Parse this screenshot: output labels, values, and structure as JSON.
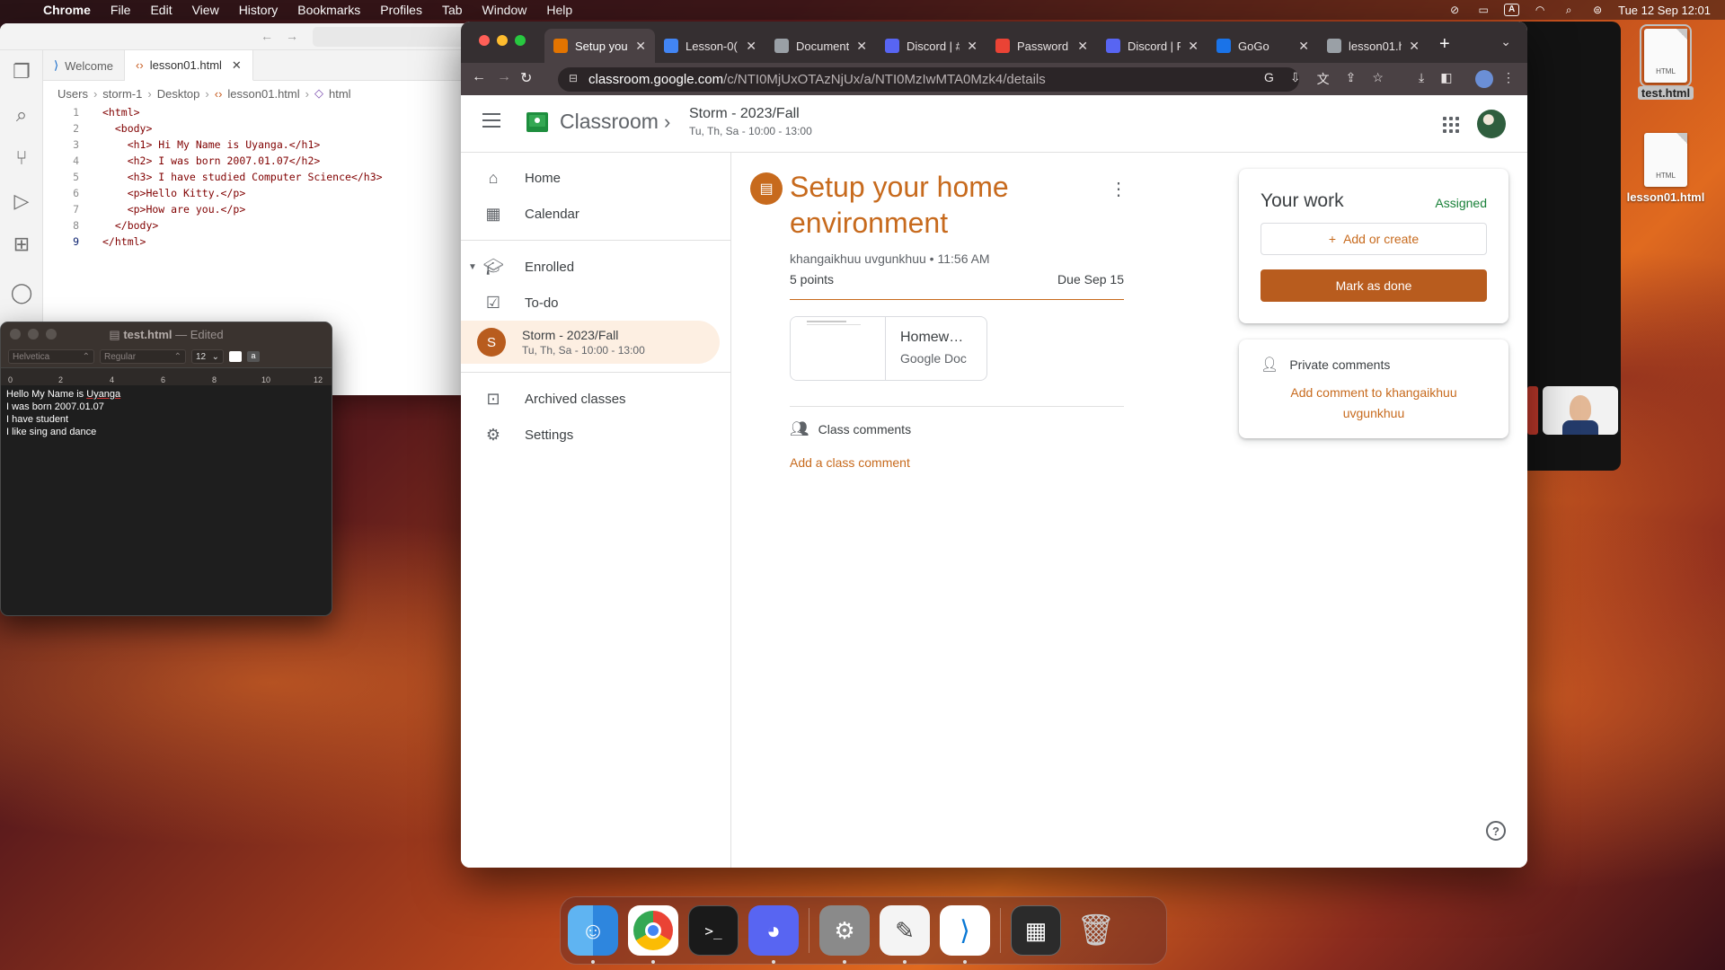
{
  "menubar": {
    "app": "Chrome",
    "items": [
      "File",
      "Edit",
      "View",
      "History",
      "Bookmarks",
      "Profiles",
      "Tab",
      "Window",
      "Help"
    ],
    "input_source": "A",
    "datetime": "Tue 12 Sep  12:01"
  },
  "vscode": {
    "tabs": [
      {
        "label": "Welcome"
      },
      {
        "label": "lesson01.html"
      }
    ],
    "breadcrumb": [
      "Users",
      "storm-1",
      "Desktop",
      "lesson01.html",
      "html"
    ],
    "lines": [
      {
        "n": "1",
        "text": "<html>"
      },
      {
        "n": "2",
        "text": "  <body>"
      },
      {
        "n": "3",
        "text": "    <h1> Hi My Name is Uyanga.</h1>"
      },
      {
        "n": "4",
        "text": "    <h2> I was born 2007.01.07</h2>"
      },
      {
        "n": "5",
        "text": "    <h3> I have studied Computer Science</h3>"
      },
      {
        "n": "6",
        "text": "    <p>Hello Kitty.</p>"
      },
      {
        "n": "7",
        "text": "    <p>How are you.</p>"
      },
      {
        "n": "8",
        "text": "  </body>"
      },
      {
        "n": "9",
        "text": "</html>"
      }
    ]
  },
  "textedit": {
    "filename": "test.html",
    "status": "— Edited",
    "font": "Helvetica",
    "style": "Regular",
    "size": "12",
    "ruler": [
      "0",
      "2",
      "4",
      "6",
      "8",
      "10",
      "12"
    ],
    "lines": [
      "Hello My Name is ",
      "Uyanga",
      "I was born 2007.01.07",
      "I have student",
      "I like sing and dance"
    ]
  },
  "chrome": {
    "tabs": [
      {
        "label": "Setup your",
        "favicon_color": "#e37400",
        "active": true
      },
      {
        "label": "Lesson-0(",
        "favicon_color": "#4285f4",
        "active": false
      },
      {
        "label": "Document",
        "favicon_color": "#9aa0a6",
        "active": false
      },
      {
        "label": "Discord | #",
        "favicon_color": "#5865f2",
        "active": false
      },
      {
        "label": "Password",
        "favicon_color": "#ea4335",
        "active": false
      },
      {
        "label": "Discord | F",
        "favicon_color": "#5865f2",
        "active": false
      },
      {
        "label": "GoGo",
        "favicon_color": "#1a73e8",
        "active": false
      },
      {
        "label": "lesson01.h",
        "favicon_color": "#9aa0a6",
        "active": false
      }
    ],
    "url_host": "classroom.google.com",
    "url_path": "/c/NTI0MjUxOTAzNjUx/a/NTI0MzIwMTA0Mzk4/details"
  },
  "classroom": {
    "app_name": "Classroom",
    "class_name": "Storm - 2023/Fall",
    "class_schedule": "Tu, Th, Sa - 10:00 - 13:00",
    "sidebar": {
      "home": "Home",
      "calendar": "Calendar",
      "enrolled": "Enrolled",
      "todo": "To-do",
      "class_initial": "S",
      "class_name": "Storm - 2023/Fall",
      "class_schedule": "Tu, Th, Sa - 10:00 - 13:00",
      "archived": "Archived classes",
      "settings": "Settings"
    },
    "assignment": {
      "title": "Setup your home environment",
      "author": "khangaikhuu uvgunkhuu",
      "time": "11:56 AM",
      "points": "5 points",
      "due": "Due Sep 15",
      "attachment_title": "Homew…",
      "attachment_type": "Google Doc",
      "class_comments": "Class comments",
      "add_class_comment": "Add a class comment"
    },
    "your_work": {
      "title": "Your work",
      "status": "Assigned",
      "add_or_create": "Add or create",
      "mark_as_done": "Mark as done"
    },
    "private_comments": {
      "title": "Private comments",
      "add": "Add comment to khangaikhuu uvgunkhuu"
    }
  },
  "desktop": {
    "icons": [
      {
        "name": "test.html",
        "tag": "HTML"
      },
      {
        "name": "lesson01.html",
        "tag": "HTML"
      }
    ]
  },
  "dock": {
    "apps": [
      "Finder",
      "Google Chrome",
      "Terminal",
      "Discord",
      "System Settings",
      "TextEdit",
      "Visual Studio Code",
      "Screenshot",
      "Trash"
    ]
  }
}
